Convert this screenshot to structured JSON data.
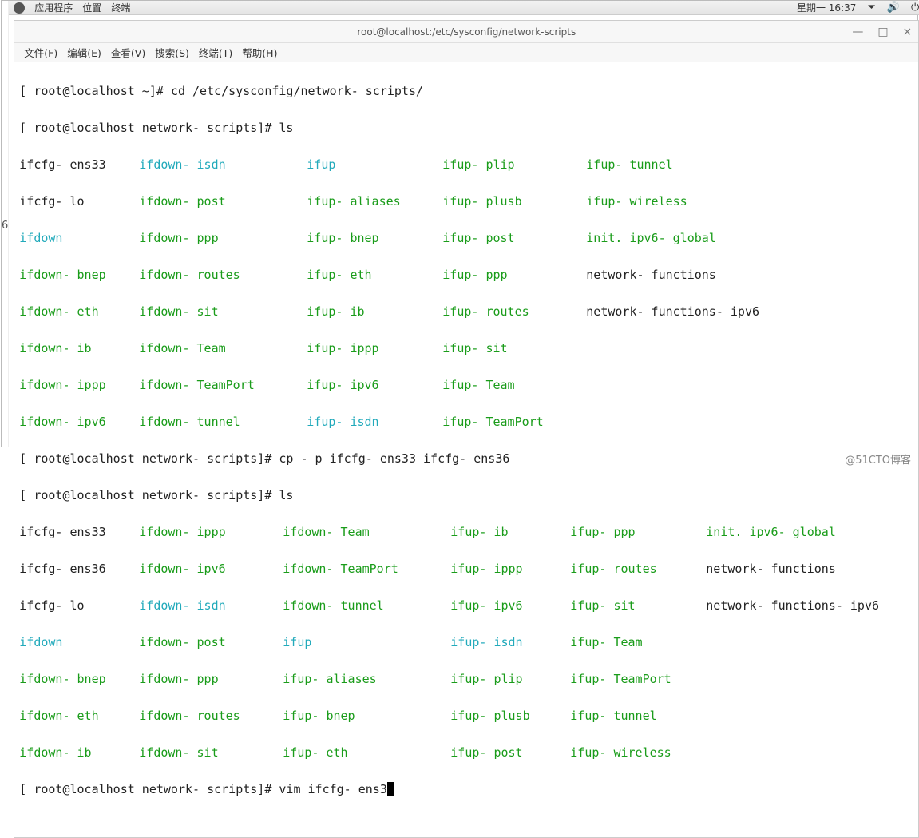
{
  "gutter_label": "6",
  "gnome": {
    "apps": "应用程序",
    "places": "位置",
    "terminal": "终端",
    "clock": "星期一 16:37"
  },
  "window": {
    "title": "root@localhost:/etc/sysconfig/network-scripts"
  },
  "menubar": {
    "file": "文件(F)",
    "edit": "编辑(E)",
    "view": "查看(V)",
    "search": "搜索(S)",
    "terminal": "终端(T)",
    "help": "帮助(H)"
  },
  "term": {
    "p1_a": "[ root@localhost ~]# ",
    "p1_b": "cd /etc/sysconfig/network- scripts/",
    "p2_a": "[ root@localhost network- scripts]# ",
    "p2_b": "ls",
    "ls1": {
      "r1": {
        "c1": "ifcfg- ens33",
        "c2": "ifdown- isdn",
        "c3": "ifup",
        "c4": "ifup- plip",
        "c5": "ifup- tunnel"
      },
      "r2": {
        "c1": "ifcfg- lo",
        "c2": "ifdown- post",
        "c3": "ifup- aliases",
        "c4": "ifup- plusb",
        "c5": "ifup- wireless"
      },
      "r3": {
        "c1": "ifdown",
        "c2": "ifdown- ppp",
        "c3": "ifup- bnep",
        "c4": "ifup- post",
        "c5": "init. ipv6- global"
      },
      "r4": {
        "c1": "ifdown- bnep",
        "c2": "ifdown- routes",
        "c3": "ifup- eth",
        "c4": "ifup- ppp",
        "c5": "network- functions"
      },
      "r5": {
        "c1": "ifdown- eth",
        "c2": "ifdown- sit",
        "c3": "ifup- ib",
        "c4": "ifup- routes",
        "c5": "network- functions- ipv6"
      },
      "r6": {
        "c1": "ifdown- ib",
        "c2": "ifdown- Team",
        "c3": "ifup- ippp",
        "c4": "ifup- sit",
        "c5": ""
      },
      "r7": {
        "c1": "ifdown- ippp",
        "c2": "ifdown- TeamPort",
        "c3": "ifup- ipv6",
        "c4": "ifup- Team",
        "c5": ""
      },
      "r8": {
        "c1": "ifdown- ipv6",
        "c2": "ifdown- tunnel",
        "c3": "ifup- isdn",
        "c4": "ifup- TeamPort",
        "c5": ""
      }
    },
    "p3_a": "[ root@localhost network- scripts]# ",
    "p3_b": "cp - p ifcfg- ens33 ifcfg- ens36",
    "p4_a": "[ root@localhost network- scripts]# ",
    "p4_b": "ls",
    "ls2": {
      "r1": {
        "c1": "ifcfg- ens33",
        "c2": "ifdown- ippp",
        "c3": "ifdown- Team",
        "c4": "ifup- ib",
        "c5": "ifup- ppp",
        "c6": "init. ipv6- global"
      },
      "r2": {
        "c1": "ifcfg- ens36",
        "c2": "ifdown- ipv6",
        "c3": "ifdown- TeamPort",
        "c4": "ifup- ippp",
        "c5": "ifup- routes",
        "c6": "network- functions"
      },
      "r3": {
        "c1": "ifcfg- lo",
        "c2": "ifdown- isdn",
        "c3": "ifdown- tunnel",
        "c4": "ifup- ipv6",
        "c5": "ifup- sit",
        "c6": "network- functions- ipv6"
      },
      "r4": {
        "c1": "ifdown",
        "c2": "ifdown- post",
        "c3": "ifup",
        "c4": "ifup- isdn",
        "c5": "ifup- Team",
        "c6": ""
      },
      "r5": {
        "c1": "ifdown- bnep",
        "c2": "ifdown- ppp",
        "c3": "ifup- aliases",
        "c4": "ifup- plip",
        "c5": "ifup- TeamPort",
        "c6": ""
      },
      "r6": {
        "c1": "ifdown- eth",
        "c2": "ifdown- routes",
        "c3": "ifup- bnep",
        "c4": "ifup- plusb",
        "c5": "ifup- tunnel",
        "c6": ""
      },
      "r7": {
        "c1": "ifdown- ib",
        "c2": "ifdown- sit",
        "c3": "ifup- eth",
        "c4": "ifup- post",
        "c5": "ifup- wireless",
        "c6": ""
      }
    },
    "p5_a": "[ root@localhost network- scripts]# ",
    "p5_b": "vim ifcfg- ens3"
  },
  "watermark": "@51CTO博客"
}
